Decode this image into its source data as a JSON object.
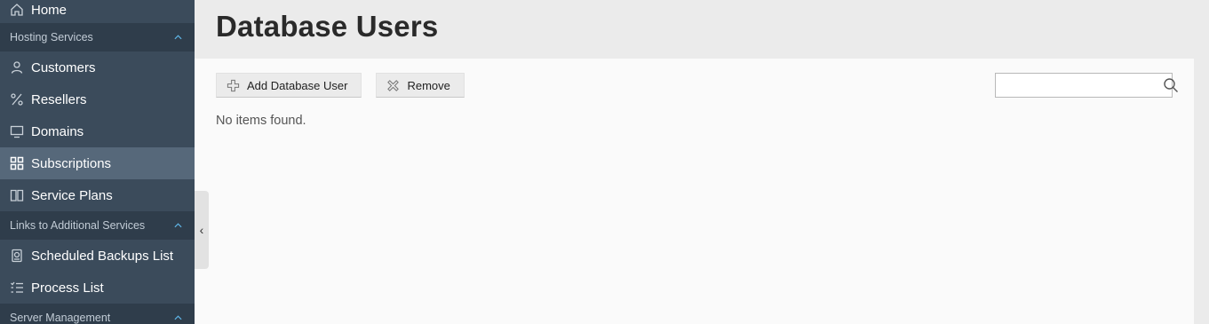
{
  "sidebar": {
    "items_top": [
      {
        "label": "Home",
        "icon": "home-icon"
      }
    ],
    "section_hosting": {
      "label": "Hosting Services",
      "chevron": "^"
    },
    "hosting_items": [
      {
        "label": "Customers",
        "icon": "user-icon"
      },
      {
        "label": "Resellers",
        "icon": "percent-icon"
      },
      {
        "label": "Domains",
        "icon": "monitor-icon"
      },
      {
        "label": "Subscriptions",
        "icon": "grid-icon",
        "active": true
      },
      {
        "label": "Service Plans",
        "icon": "book-icon"
      }
    ],
    "section_links": {
      "label": "Links to Additional Services",
      "chevron": "^"
    },
    "links_items": [
      {
        "label": "Scheduled Backups List",
        "icon": "backup-icon"
      },
      {
        "label": "Process List",
        "icon": "checklist-icon"
      }
    ],
    "section_server": {
      "label": "Server Management",
      "chevron": "^"
    },
    "collapse_glyph": "‹"
  },
  "page": {
    "title": "Database Users"
  },
  "toolbar": {
    "add_label": "Add Database User",
    "remove_label": "Remove"
  },
  "search": {
    "value": "",
    "placeholder": ""
  },
  "content": {
    "empty_message": "No items found."
  },
  "colors": {
    "sidebar_bg": "#3b4b5b",
    "sidebar_active": "#56687a",
    "section_bg": "#2f3d4b",
    "accent_chevron": "#5fb5e6",
    "content_bg": "#fafafa",
    "header_bg": "#ebebeb"
  }
}
